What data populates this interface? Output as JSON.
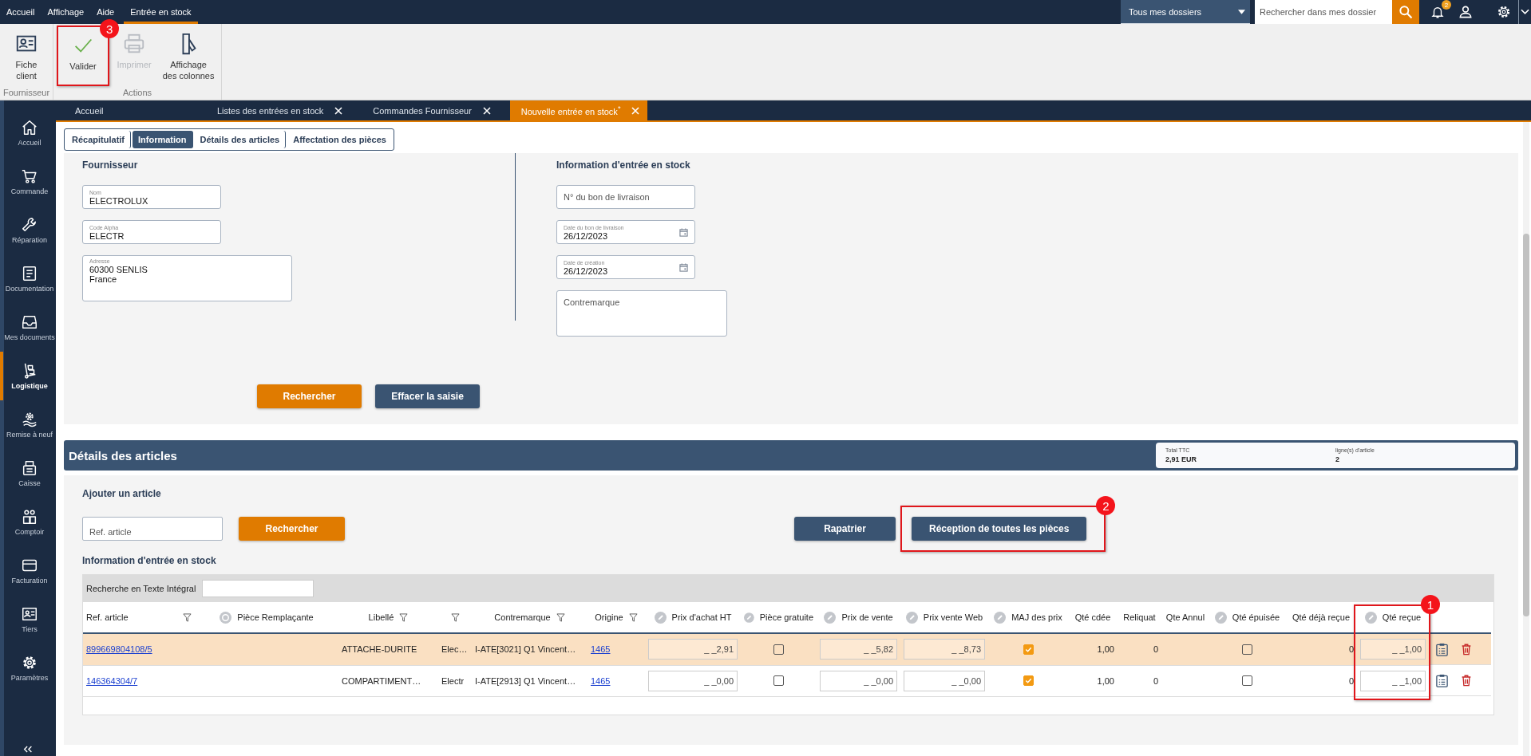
{
  "menu_bar": {
    "items": [
      {
        "label": "Accueil",
        "selected": false
      },
      {
        "label": "Affichage",
        "selected": false
      },
      {
        "label": "Aide",
        "selected": false
      },
      {
        "label": "Entrée en stock",
        "selected": true
      }
    ],
    "folder_select": {
      "value": "Tous mes dossiers"
    },
    "search": {
      "placeholder": "Rechercher dans mes dossier"
    },
    "notifications": {
      "count": "2"
    }
  },
  "ribbon": {
    "groups": [
      {
        "label": "Fournisseur",
        "buttons": [
          {
            "label": "Fiche client",
            "kind": "card",
            "disabled": false
          }
        ]
      },
      {
        "label": "Actions",
        "buttons": [
          {
            "label": "Valider",
            "kind": "check",
            "disabled": false,
            "callout": "3"
          },
          {
            "label": "Imprimer",
            "kind": "printer",
            "disabled": true
          },
          {
            "label": "Affichage des colonnes",
            "kind": "columns",
            "disabled": false
          }
        ]
      }
    ]
  },
  "doc_tabs": [
    {
      "label": "Accueil",
      "closable": false,
      "selected": false
    },
    {
      "label": "Listes des entrées en stock",
      "closable": true,
      "selected": false
    },
    {
      "label": "Commandes Fournisseur",
      "closable": true,
      "selected": false
    },
    {
      "label": "Nouvelle entrée en stock$^{*}$",
      "closable": true,
      "selected": true
    }
  ],
  "sidebar": {
    "items": [
      {
        "label": "Accueil",
        "kind": "home",
        "selected": false
      },
      {
        "label": "Commande",
        "kind": "cart",
        "selected": false
      },
      {
        "label": "Réparation",
        "kind": "wrench",
        "selected": false
      },
      {
        "label": "Documentation",
        "kind": "doc",
        "selected": false
      },
      {
        "label": "Mes documents",
        "kind": "tray",
        "selected": false
      },
      {
        "label": "Logistique",
        "kind": "truck",
        "selected": true
      },
      {
        "label": "Remise à neuf",
        "kind": "refurb",
        "selected": false
      },
      {
        "label": "Caisse",
        "kind": "register",
        "selected": false
      },
      {
        "label": "Comptoir",
        "kind": "people",
        "selected": false
      },
      {
        "label": "Facturation",
        "kind": "creditcard",
        "selected": false
      },
      {
        "label": "Tiers",
        "kind": "idcard",
        "selected": false
      },
      {
        "label": "Paramètres",
        "kind": "gear",
        "selected": false
      }
    ]
  },
  "sub_tabs": [
    {
      "label": "Récapitulatif",
      "selected": false
    },
    {
      "label": "Information",
      "selected": true
    },
    {
      "label": "Détails des articles",
      "selected": false
    },
    {
      "label": "Affectation des pièces",
      "selected": false
    }
  ],
  "supplier": {
    "title": "Fournisseur",
    "fields": [
      {
        "kind": "text",
        "label": "Nom",
        "value": "ELECTROLUX"
      },
      {
        "kind": "text",
        "label": "Code Alpha",
        "value": "ELECTR"
      },
      {
        "kind": "area",
        "label": "Adresse",
        "value": "60300 SENLIS\nFrance"
      }
    ]
  },
  "stock_info": {
    "title": "Information d'entrée en stock",
    "fields": [
      {
        "kind": "text",
        "placeholder": "N° du bon de livraison"
      },
      {
        "kind": "date",
        "label": "Date du bon de livraison",
        "value": "26/12/2023"
      },
      {
        "kind": "date",
        "label": "Date de création",
        "value": "26/12/2023"
      },
      {
        "kind": "area",
        "placeholder": "Contremarque"
      }
    ]
  },
  "form_buttons": [
    {
      "label": "Rechercher",
      "kind": "primary"
    },
    {
      "label": "Effacer la saisie",
      "kind": "secondary"
    }
  ],
  "details": {
    "title": "Détails des articles",
    "summary": [
      {
        "label": "Total TTC",
        "value": "2,91 EUR"
      },
      {
        "label": "ligne(s) d'article",
        "value": "2"
      }
    ],
    "add_title": "Ajouter un article",
    "ref_field": {
      "placeholder": "Ref. article"
    },
    "buttons": [
      {
        "label": "Rechercher",
        "kind": "primary"
      },
      {
        "label": "Rapatrier",
        "kind": "secondary"
      },
      {
        "label": "Réception de toutes les pièces",
        "kind": "secondary",
        "callout": "2"
      }
    ],
    "grid_title": "Information d'entrée en stock",
    "fulltext": {
      "label": "Recherche en Texte Intégral"
    },
    "columns": [
      {
        "label": "Ref. article",
        "kind": "plain",
        "filter": true
      },
      {
        "label": "Pièce Remplaçante",
        "kind": "replace"
      },
      {
        "label": "Libellé",
        "kind": "plain",
        "filter": true
      },
      {
        "kind": "plain",
        "filter": true
      },
      {
        "label": "Contremarque",
        "kind": "plain",
        "filter": true
      },
      {
        "label": "Origine",
        "kind": "plain",
        "filter": true
      },
      {
        "label": "Prix d'achat HT",
        "kind": "editable"
      },
      {
        "label": "Pièce gratuite",
        "kind": "editable"
      },
      {
        "label": "Prix de vente",
        "kind": "editable"
      },
      {
        "label": "Prix vente Web",
        "kind": "editable"
      },
      {
        "label": "MAJ des prix",
        "kind": "editable"
      },
      {
        "label": "Qté cdée",
        "kind": "plain"
      },
      {
        "label": "Reliquat",
        "kind": "plain"
      },
      {
        "label": "Qte Annul",
        "kind": "plain"
      },
      {
        "label": "Qté épuisée",
        "kind": "editable"
      },
      {
        "label": "Qté déjà reçue",
        "kind": "plain"
      },
      {
        "label": "Qté reçue",
        "kind": "editable",
        "callout": "1"
      }
    ],
    "rows": [
      {
        "selected": true,
        "cells": [
          {
            "kind": "link",
            "value": "899669804108/5"
          },
          {
            "kind": "empty"
          },
          {
            "kind": "text",
            "value": "ATTACHE-DURITE"
          },
          {
            "kind": "text",
            "value": "Elec…"
          },
          {
            "kind": "text",
            "value": "I-ATE[3021] Q1 Vincent…"
          },
          {
            "kind": "link",
            "value": "1465"
          },
          {
            "kind": "input",
            "value": "_ _2,91"
          },
          {
            "kind": "check",
            "checked": false
          },
          {
            "kind": "input",
            "value": "_ _5,82"
          },
          {
            "kind": "input",
            "value": "_ _8,73"
          },
          {
            "kind": "check",
            "checked": true
          },
          {
            "kind": "num",
            "value": "1,00"
          },
          {
            "kind": "num",
            "value": "0"
          },
          {
            "kind": "empty"
          },
          {
            "kind": "check",
            "checked": false
          },
          {
            "kind": "num",
            "value": "0"
          },
          {
            "kind": "input",
            "value": "_ _1,00"
          }
        ]
      },
      {
        "selected": false,
        "cells": [
          {
            "kind": "link",
            "value": "146364304/7"
          },
          {
            "kind": "empty"
          },
          {
            "kind": "text",
            "value": "COMPARTIMENT…"
          },
          {
            "kind": "text",
            "value": "Electr"
          },
          {
            "kind": "text",
            "value": "I-ATE[2913] Q1 Vincent…"
          },
          {
            "kind": "link",
            "value": "1465"
          },
          {
            "kind": "input",
            "value": "_ _0,00"
          },
          {
            "kind": "check",
            "checked": false
          },
          {
            "kind": "input",
            "value": "_ _0,00"
          },
          {
            "kind": "input",
            "value": "_ _0,00"
          },
          {
            "kind": "check",
            "checked": true
          },
          {
            "kind": "num",
            "value": "1,00"
          },
          {
            "kind": "num",
            "value": "0"
          },
          {
            "kind": "empty"
          },
          {
            "kind": "check",
            "checked": false
          },
          {
            "kind": "num",
            "value": "0"
          },
          {
            "kind": "input",
            "value": "_ _1,00"
          }
        ]
      }
    ]
  }
}
